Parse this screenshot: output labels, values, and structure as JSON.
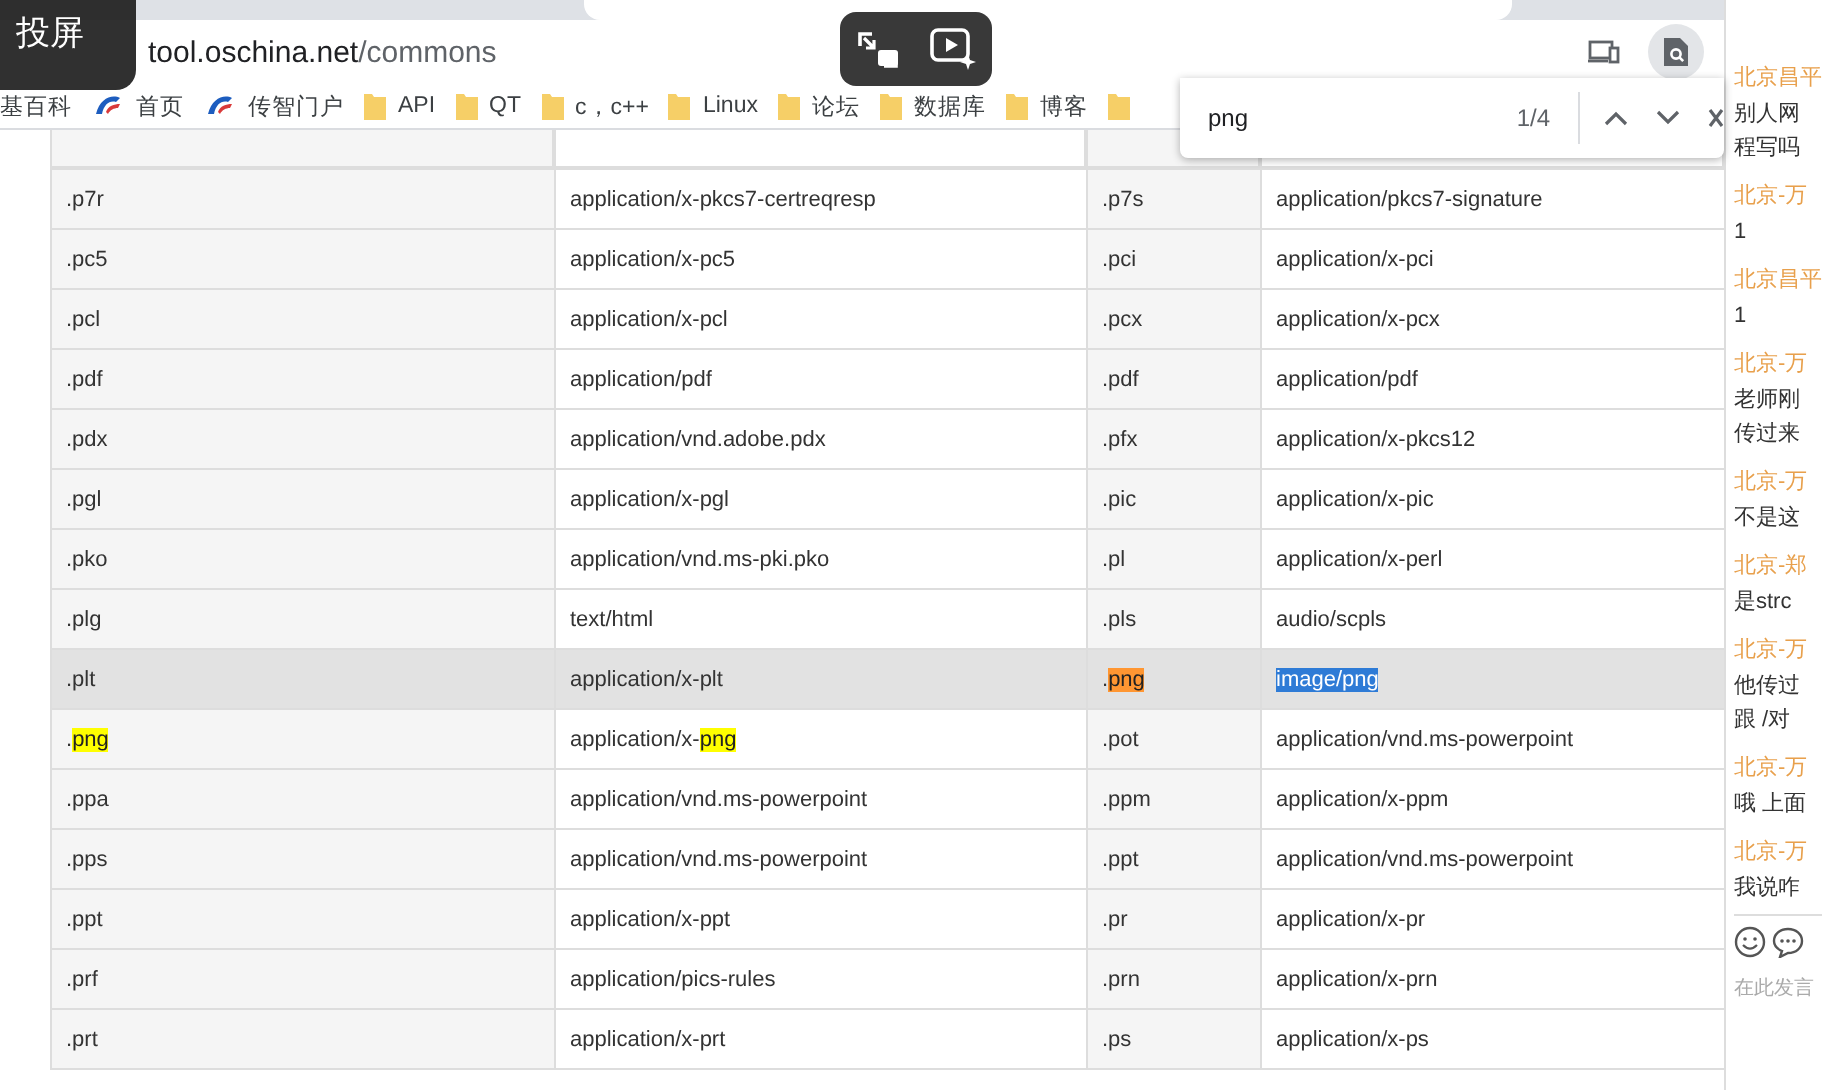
{
  "address_bar": {
    "url_host": "tool.oschina.net",
    "url_path": "/commons"
  },
  "bookmarks": [
    {
      "kind": "plain",
      "label": "基百科"
    },
    {
      "kind": "site",
      "label": "首页"
    },
    {
      "kind": "site",
      "label": "传智门户"
    },
    {
      "kind": "folder",
      "label": "API"
    },
    {
      "kind": "folder",
      "label": "QT"
    },
    {
      "kind": "folder",
      "label": "c，c++"
    },
    {
      "kind": "folder",
      "label": "Linux"
    },
    {
      "kind": "folder",
      "label": "论坛"
    },
    {
      "kind": "folder",
      "label": "数据库"
    },
    {
      "kind": "folder",
      "label": "博客"
    },
    {
      "kind": "folder"
    }
  ],
  "cast_badge": {
    "label": "投屏"
  },
  "find_bar": {
    "query": "png",
    "count": "1/4"
  },
  "table": {
    "rows": [
      {
        "hovered": false,
        "cells": [
          [
            {
              "kind": "plain",
              "text": ".p7r"
            }
          ],
          [
            {
              "kind": "plain",
              "text": "application/x-pkcs7-certreqresp"
            }
          ],
          [
            {
              "kind": "plain",
              "text": ".p7s"
            }
          ],
          [
            {
              "kind": "plain",
              "text": "application/pkcs7-signature"
            }
          ]
        ]
      },
      {
        "hovered": false,
        "cells": [
          [
            {
              "kind": "plain",
              "text": ".pc5"
            }
          ],
          [
            {
              "kind": "plain",
              "text": "application/x-pc5"
            }
          ],
          [
            {
              "kind": "plain",
              "text": ".pci"
            }
          ],
          [
            {
              "kind": "plain",
              "text": "application/x-pci"
            }
          ]
        ]
      },
      {
        "hovered": false,
        "cells": [
          [
            {
              "kind": "plain",
              "text": ".pcl"
            }
          ],
          [
            {
              "kind": "plain",
              "text": "application/x-pcl"
            }
          ],
          [
            {
              "kind": "plain",
              "text": ".pcx"
            }
          ],
          [
            {
              "kind": "plain",
              "text": "application/x-pcx"
            }
          ]
        ]
      },
      {
        "hovered": false,
        "cells": [
          [
            {
              "kind": "plain",
              "text": ".pdf"
            }
          ],
          [
            {
              "kind": "plain",
              "text": "application/pdf"
            }
          ],
          [
            {
              "kind": "plain",
              "text": ".pdf"
            }
          ],
          [
            {
              "kind": "plain",
              "text": "application/pdf"
            }
          ]
        ]
      },
      {
        "hovered": false,
        "cells": [
          [
            {
              "kind": "plain",
              "text": ".pdx"
            }
          ],
          [
            {
              "kind": "plain",
              "text": "application/vnd.adobe.pdx"
            }
          ],
          [
            {
              "kind": "plain",
              "text": ".pfx"
            }
          ],
          [
            {
              "kind": "plain",
              "text": "application/x-pkcs12"
            }
          ]
        ]
      },
      {
        "hovered": false,
        "cells": [
          [
            {
              "kind": "plain",
              "text": ".pgl"
            }
          ],
          [
            {
              "kind": "plain",
              "text": "application/x-pgl"
            }
          ],
          [
            {
              "kind": "plain",
              "text": ".pic"
            }
          ],
          [
            {
              "kind": "plain",
              "text": "application/x-pic"
            }
          ]
        ]
      },
      {
        "hovered": false,
        "cells": [
          [
            {
              "kind": "plain",
              "text": ".pko"
            }
          ],
          [
            {
              "kind": "plain",
              "text": "application/vnd.ms-pki.pko"
            }
          ],
          [
            {
              "kind": "plain",
              "text": ".pl"
            }
          ],
          [
            {
              "kind": "plain",
              "text": "application/x-perl"
            }
          ]
        ]
      },
      {
        "hovered": false,
        "cells": [
          [
            {
              "kind": "plain",
              "text": ".plg"
            }
          ],
          [
            {
              "kind": "plain",
              "text": "text/html"
            }
          ],
          [
            {
              "kind": "plain",
              "text": ".pls"
            }
          ],
          [
            {
              "kind": "plain",
              "text": "audio/scpls"
            }
          ]
        ]
      },
      {
        "hovered": true,
        "cells": [
          [
            {
              "kind": "plain",
              "text": ".plt"
            }
          ],
          [
            {
              "kind": "plain",
              "text": "application/x-plt"
            }
          ],
          [
            {
              "kind": "plain",
              "text": "."
            },
            {
              "kind": "current",
              "text": "png"
            }
          ],
          [
            {
              "kind": "selection",
              "text": "image/png"
            }
          ]
        ]
      },
      {
        "hovered": false,
        "cells": [
          [
            {
              "kind": "plain",
              "text": "."
            },
            {
              "kind": "match",
              "text": "png"
            }
          ],
          [
            {
              "kind": "plain",
              "text": "application/x-"
            },
            {
              "kind": "match",
              "text": "png"
            }
          ],
          [
            {
              "kind": "plain",
              "text": ".pot"
            }
          ],
          [
            {
              "kind": "plain",
              "text": "application/vnd.ms-powerpoint"
            }
          ]
        ]
      },
      {
        "hovered": false,
        "cells": [
          [
            {
              "kind": "plain",
              "text": ".ppa"
            }
          ],
          [
            {
              "kind": "plain",
              "text": "application/vnd.ms-powerpoint"
            }
          ],
          [
            {
              "kind": "plain",
              "text": ".ppm"
            }
          ],
          [
            {
              "kind": "plain",
              "text": "application/x-ppm"
            }
          ]
        ]
      },
      {
        "hovered": false,
        "cells": [
          [
            {
              "kind": "plain",
              "text": ".pps"
            }
          ],
          [
            {
              "kind": "plain",
              "text": "application/vnd.ms-powerpoint"
            }
          ],
          [
            {
              "kind": "plain",
              "text": ".ppt"
            }
          ],
          [
            {
              "kind": "plain",
              "text": "application/vnd.ms-powerpoint"
            }
          ]
        ]
      },
      {
        "hovered": false,
        "cells": [
          [
            {
              "kind": "plain",
              "text": ".ppt"
            }
          ],
          [
            {
              "kind": "plain",
              "text": "application/x-ppt"
            }
          ],
          [
            {
              "kind": "plain",
              "text": ".pr"
            }
          ],
          [
            {
              "kind": "plain",
              "text": "application/x-pr"
            }
          ]
        ]
      },
      {
        "hovered": false,
        "cells": [
          [
            {
              "kind": "plain",
              "text": ".prf"
            }
          ],
          [
            {
              "kind": "plain",
              "text": "application/pics-rules"
            }
          ],
          [
            {
              "kind": "plain",
              "text": ".prn"
            }
          ],
          [
            {
              "kind": "plain",
              "text": "application/x-prn"
            }
          ]
        ]
      },
      {
        "hovered": false,
        "cells": [
          [
            {
              "kind": "plain",
              "text": ".prt"
            }
          ],
          [
            {
              "kind": "plain",
              "text": "application/x-prt"
            }
          ],
          [
            {
              "kind": "plain",
              "text": ".ps"
            }
          ],
          [
            {
              "kind": "plain",
              "text": "application/x-ps"
            }
          ]
        ]
      }
    ]
  },
  "chat": {
    "messages": [
      {
        "sender": "北京昌平",
        "lines": [
          "别人网",
          "程写吗"
        ]
      },
      {
        "sender": "北京-万",
        "lines": [
          "1"
        ]
      },
      {
        "sender": "北京昌平",
        "lines": [
          "1"
        ]
      },
      {
        "sender": "北京-万",
        "lines": [
          "老师刚",
          "传过来"
        ]
      },
      {
        "sender": "北京-万",
        "lines": [
          "不是这"
        ]
      },
      {
        "sender": "北京-郑",
        "lines": [
          "是strc"
        ]
      },
      {
        "sender": "北京-万",
        "lines": [
          "他传过",
          "跟 /对"
        ]
      },
      {
        "sender": "北京-万",
        "lines": [
          "哦 上面"
        ]
      },
      {
        "sender": "北京-万",
        "lines": [
          "我说咋"
        ]
      }
    ],
    "input_placeholder": "在此发言"
  }
}
